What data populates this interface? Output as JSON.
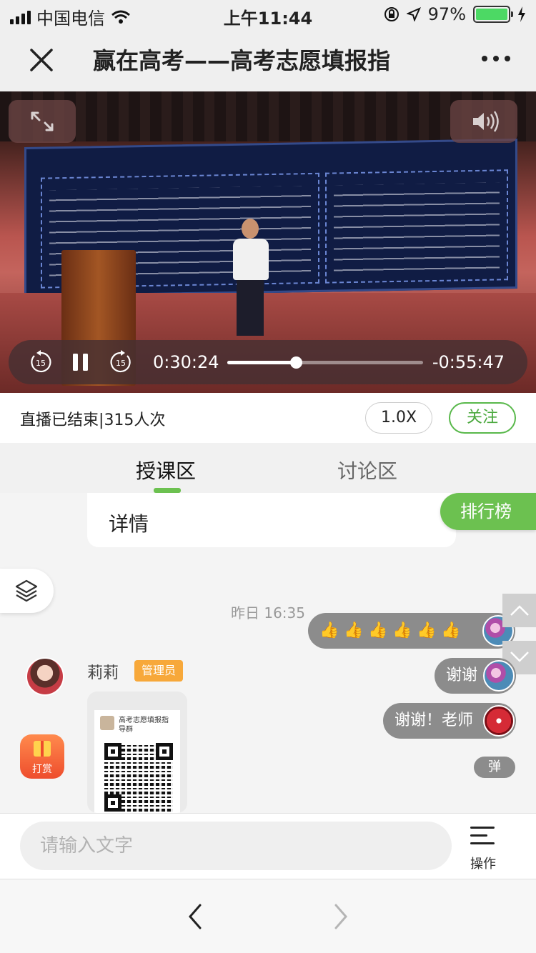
{
  "status_bar": {
    "carrier": "中国电信",
    "time": "上午11:44",
    "battery": "97%"
  },
  "nav": {
    "title": "赢在高考——高考志愿填报指",
    "close_icon": "close-icon",
    "more_icon": "more-icon"
  },
  "player": {
    "current_time": "0:30:24",
    "remaining_time": "-0:55:47",
    "progress": 0.35,
    "skip_back_label": "15",
    "skip_forward_label": "15"
  },
  "info": {
    "status": "直播已结束",
    "separator": "|",
    "viewers": "315人次",
    "speed": "1.0X",
    "follow": "关注"
  },
  "tabs": [
    {
      "label": "授课区",
      "active": true
    },
    {
      "label": "讨论区",
      "active": false
    }
  ],
  "detail_label": "详情",
  "rank_label": "排行榜",
  "chat": {
    "timestamp": "昨日 16:35",
    "thumbs": [
      "👍",
      "👍",
      "👍",
      "👍",
      "👍",
      "👍"
    ],
    "messages_right": [
      {
        "text": "谢谢"
      },
      {
        "text": "谢谢！老师"
      }
    ],
    "admin": {
      "name": "莉莉",
      "badge": "管理员"
    },
    "qr_card": {
      "title": "高考志愿填报指导群"
    }
  },
  "gift_label": "打赏",
  "barrage_label": "弹",
  "input": {
    "placeholder": "请输入文字"
  },
  "ops_label": "操作",
  "colors": {
    "accent_green": "#6cc150",
    "bubble_grey": "#8c8c8c",
    "badge_orange": "#f7a83a"
  }
}
